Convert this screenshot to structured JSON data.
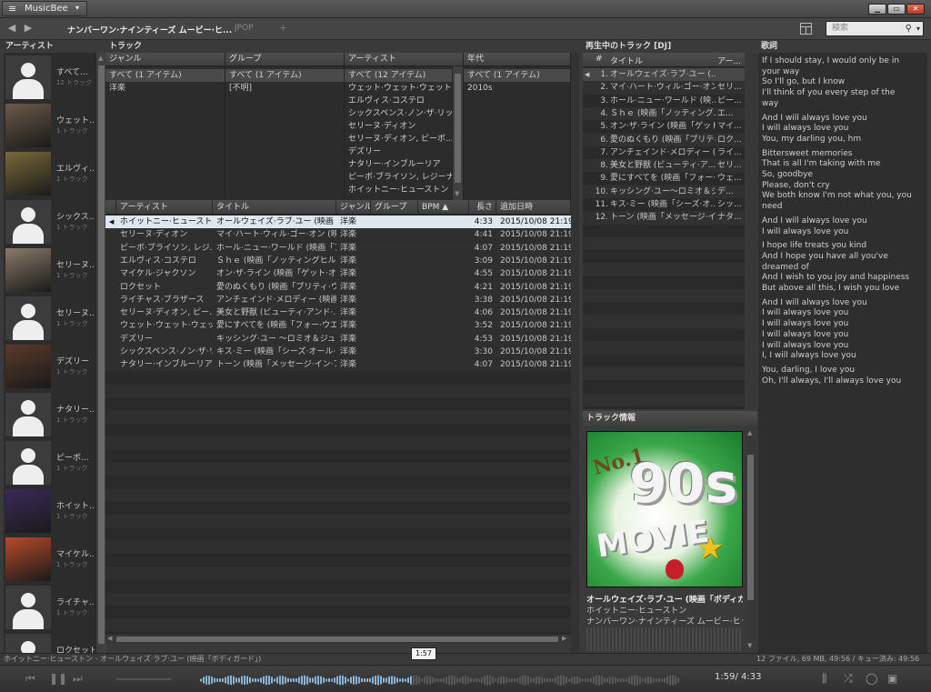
{
  "app": {
    "name": "MusicBee"
  },
  "window": {
    "minimize": "▁",
    "maximize": "▭",
    "close": "✕"
  },
  "toolbar": {
    "tabs": [
      "ナンバーワン·ナインティーズ ムービー·ヒ...",
      "JPOP",
      "+"
    ],
    "search_placeholder": "検索"
  },
  "headers": {
    "artists": "アーティスト",
    "tracks": "トラック",
    "now_playing": "再生中のトラック [DJ]",
    "lyrics": "歌詞",
    "track_info": "トラック情報"
  },
  "artists": [
    {
      "name": "すべて...",
      "count": "12 トラック"
    },
    {
      "name": "ウェット...",
      "count": "1 トラック"
    },
    {
      "name": "エルヴィ...",
      "count": "1 トラック"
    },
    {
      "name": "シックス...",
      "count": "1 トラック"
    },
    {
      "name": "セリーヌ...",
      "count": "1 トラック"
    },
    {
      "name": "セリーヌ...",
      "count": "1 トラック"
    },
    {
      "name": "デズリー",
      "count": "1 トラック"
    },
    {
      "name": "ナタリー...",
      "count": "1 トラック"
    },
    {
      "name": "ピーボ...",
      "count": "1 トラック"
    },
    {
      "name": "ホイット...",
      "count": "1 トラック"
    },
    {
      "name": "マイケル...",
      "count": "1 トラック"
    },
    {
      "name": "ライチャ...",
      "count": "1 トラック"
    },
    {
      "name": "ロクセット",
      "count": ""
    }
  ],
  "filters": {
    "genre": {
      "title": "ジャンル",
      "rows": [
        "すべて (1 アイテム)",
        "洋楽"
      ]
    },
    "group": {
      "title": "グループ",
      "rows": [
        "すべて (1 アイテム)",
        "[不明]"
      ]
    },
    "artist": {
      "title": "アーティスト",
      "rows": [
        "すべて (12 アイテム)",
        "ウェット·ウェット·ウェット",
        "エルヴィス·コステロ",
        "シックスペンス·ノン·ザ·リッチ...",
        "セリーヌ·ディオン",
        "セリーヌ·ディオン, ピーボ...",
        "デズリー",
        "ナタリー·インブルーリア",
        "ピーボ·ブライソン, レジーナ...",
        "ホイットニー·ヒューストン"
      ]
    },
    "year": {
      "title": "年代",
      "rows": [
        "すべて (1 アイテム)",
        "2010s"
      ]
    }
  },
  "track_columns": [
    "アーティスト",
    "タイトル",
    "ジャンル",
    "グループ",
    "BPM ▲",
    "長さ",
    "追加日時"
  ],
  "tracks": [
    {
      "artist": "ホイットニー·ヒューストン",
      "title": "オールウェイズ·ラブ·ユー (映画「...",
      "genre": "洋楽",
      "length": "4:33",
      "added": "2015/10/08 21:19",
      "playing": true
    },
    {
      "artist": "セリーヌ·ディオン",
      "title": "マイ·ハート·ウィル·ゴー·オン (映...",
      "genre": "洋楽",
      "length": "4:41",
      "added": "2015/10/08 21:19"
    },
    {
      "artist": "ピーボ·ブライソン, レジ...",
      "title": "ホール·ニュー·ワールド (映画「ア...",
      "genre": "洋楽",
      "length": "4:07",
      "added": "2015/10/08 21:19"
    },
    {
      "artist": "エルヴィス·コステロ",
      "title": "Ｓｈｅ (映画「ノッティングヒルの...",
      "genre": "洋楽",
      "length": "3:09",
      "added": "2015/10/08 21:19"
    },
    {
      "artist": "マイケル·ジャクソン",
      "title": "オン·ザ·ライン (映画「ゲット·オン...",
      "genre": "洋楽",
      "length": "4:55",
      "added": "2015/10/08 21:19"
    },
    {
      "artist": "ロクセット",
      "title": "愛のぬくもり (映画「プリティ·ウー...",
      "genre": "洋楽",
      "length": "4:21",
      "added": "2015/10/08 21:19"
    },
    {
      "artist": "ライチャス·ブラザース",
      "title": "アンチェインド·メロディー (映画「...",
      "genre": "洋楽",
      "length": "3:38",
      "added": "2015/10/08 21:19"
    },
    {
      "artist": "セリーヌ·ディオン, ピー...",
      "title": "美女と野獣 (ビューティ·アンド·...",
      "genre": "洋楽",
      "length": "4:06",
      "added": "2015/10/08 21:19"
    },
    {
      "artist": "ウェット·ウェット·ウェット",
      "title": "愛にすべてを (映画「フォー·ウエ...",
      "genre": "洋楽",
      "length": "3:52",
      "added": "2015/10/08 21:19"
    },
    {
      "artist": "デズリー",
      "title": "キッシング·ユー ～ロミオ＆ジュリエ...",
      "genre": "洋楽",
      "length": "4:53",
      "added": "2015/10/08 21:19"
    },
    {
      "artist": "シックスペンス·ノン·ザ·リ...",
      "title": "キス·ミー (映画「シーズ·オール·...",
      "genre": "洋楽",
      "length": "3:30",
      "added": "2015/10/08 21:19"
    },
    {
      "artist": "ナタリー·インブルーリア",
      "title": "トーン (映画「メッセージ·イン·ア...",
      "genre": "洋楽",
      "length": "4:07",
      "added": "2015/10/08 21:19"
    }
  ],
  "now_playing_columns": [
    "#",
    "タイトル",
    "アー..."
  ],
  "now_playing": [
    {
      "num": "1.",
      "title": "オールウェイズ·ラブ·ユー (...",
      "artist": "",
      "playing": true
    },
    {
      "num": "2.",
      "title": "マイ·ハート·ウィル·ゴー·オン...",
      "artist": "セリ..."
    },
    {
      "num": "3.",
      "title": "ホール·ニュー·ワールド (映...",
      "artist": "ピー..."
    },
    {
      "num": "4.",
      "title": "Ｓｈｅ (映画「ノッティング...",
      "artist": "エ..."
    },
    {
      "num": "5.",
      "title": "オン·ザ·ライン (映画「ゲット...",
      "artist": "マイ..."
    },
    {
      "num": "6.",
      "title": "愛のぬくもり (映画「プリティ...",
      "artist": "ロク..."
    },
    {
      "num": "7.",
      "title": "アンチェインド·メロディー (...",
      "artist": "ライ..."
    },
    {
      "num": "8.",
      "title": "美女と野獣 (ビューティ·ア...",
      "artist": "セリ..."
    },
    {
      "num": "9.",
      "title": "愛にすべてを (映画「フォー·...",
      "artist": "ウェ..."
    },
    {
      "num": "10.",
      "title": "キッシング·ユー～ロミオ＆ジ...",
      "artist": "デ..."
    },
    {
      "num": "11.",
      "title": "キス·ミー (映画「シーズ·オ...",
      "artist": "シッ..."
    },
    {
      "num": "12.",
      "title": "トーン (映画「メッセージ·イ...",
      "artist": "ナタ..."
    }
  ],
  "lyrics": [
    "If I should stay, I would only be in\nyour way\nSo I'll go, but I know\nI'll think of you every step of the\nway",
    "And I will always love you\nI will always love you\nYou, my darling you, hm",
    "Bittersweet memories\nThat is all I'm taking with me\nSo, goodbye\nPlease, don't cry\nWe both know I'm not what you, you\nneed",
    "And I will always love you\nI will always love you",
    "I hope life treats you kind\nAnd I hope you have all you've\ndreamed of\nAnd I wish to you joy and happiness\nBut above all this, I wish you love",
    "And I will always love you\nI will always love you\nI will always love you\nI will always love you\nI will always love you\nI, I will always love you",
    "You, darling, I love you\nOh, I'll always, I'll always love you"
  ],
  "track_info": {
    "title": "オールウェイズ·ラブ·ユー (映画「ボディガー...",
    "artist": "ホイットニー·ヒューストン",
    "album": "ナンバーワン·ナインティーズ ムービー·ヒッツ D...",
    "art_text_top": "No.1",
    "art_text_mid": "90s",
    "art_text_bottom": "MOVIE"
  },
  "status": {
    "left": "ホイットニー·ヒューストン - オールウェイズ·ラブ·ユー (映画「ボディガード」)",
    "right": "12 ファイル, 69 MB, 49:56 /  キュー済み: 49:56"
  },
  "player": {
    "position": "1:59",
    "total": "4:33",
    "progress_fraction": 0.436,
    "tooltip": "1:57"
  },
  "colors": {
    "accent": "#8ab4d8",
    "selection": "#dfe6ee"
  }
}
